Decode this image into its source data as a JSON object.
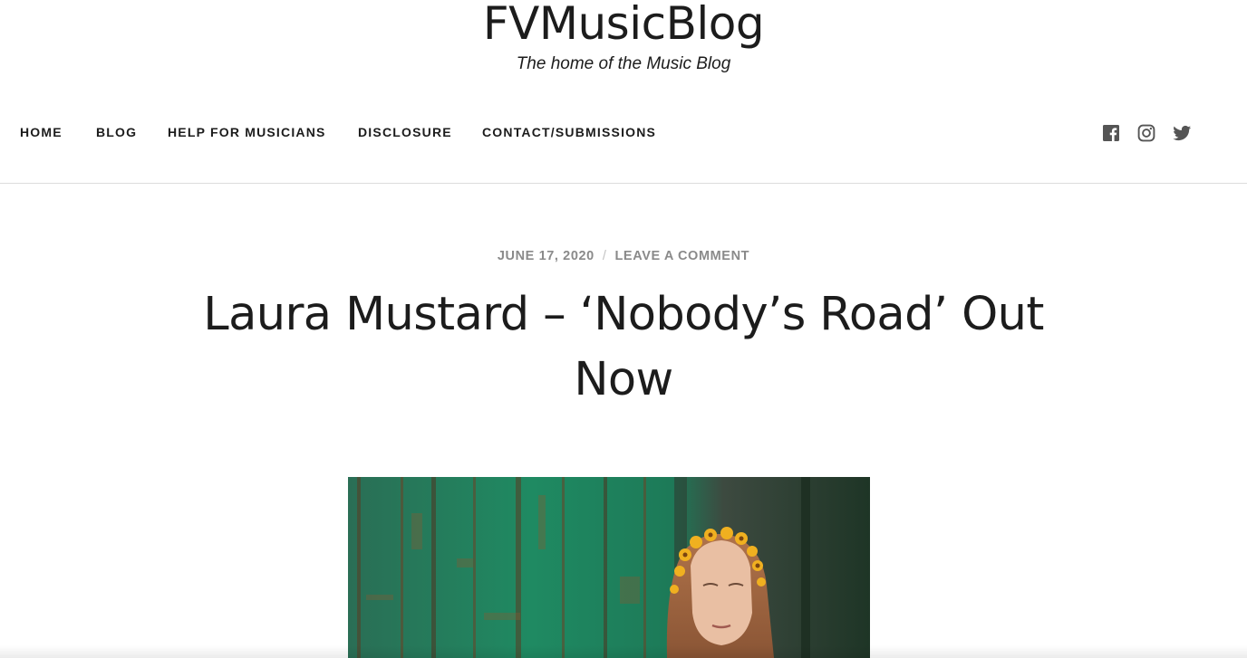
{
  "site": {
    "title": "FVMusicBlog",
    "tagline": "The home of the Music Blog"
  },
  "nav": {
    "items": [
      {
        "label": "HOME"
      },
      {
        "label": "BLOG"
      },
      {
        "label": "HELP FOR MUSICIANS"
      },
      {
        "label": "DISCLOSURE"
      },
      {
        "label": "CONTACT/SUBMISSIONS"
      }
    ]
  },
  "social": {
    "icons": [
      "facebook-icon",
      "instagram-icon",
      "twitter-icon"
    ],
    "color": "#555555"
  },
  "post": {
    "date": "JUNE 17, 2020",
    "separator": "/",
    "comment_link": "LEAVE A COMMENT",
    "title": "Laura Mustard – ‘Nobody’s Road’ Out Now"
  },
  "colors": {
    "text": "#1c1c1c",
    "meta": "#8a8a8a",
    "divider": "#dcdcdc",
    "photo_green": "#1f7a58"
  }
}
